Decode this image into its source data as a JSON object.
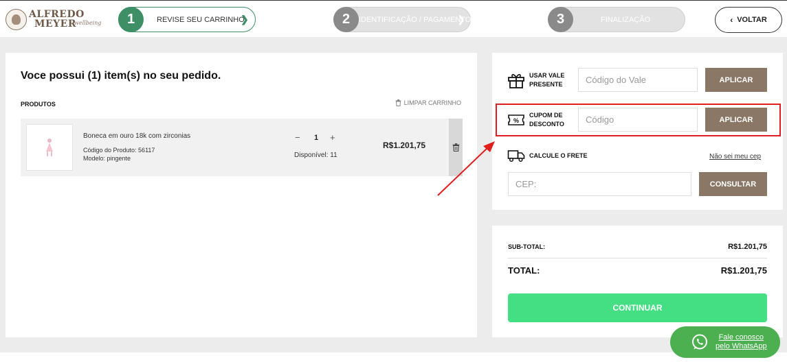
{
  "header": {
    "logo": {
      "line1": "ALFREDO",
      "line2": "MEYER",
      "script": "wellbeing"
    },
    "steps": [
      {
        "num": "1",
        "label": "REVISE SEU CARRINHO"
      },
      {
        "num": "2",
        "label": "IDENTIFICAÇÃO / PAGAMENTO"
      },
      {
        "num": "3",
        "label": "FINALIZAÇÃO"
      }
    ],
    "back_label": "VOLTAR"
  },
  "cart": {
    "title": "Voce possui (1) item(s) no seu pedido.",
    "products_header": "PRODUTOS",
    "clear_label": "LIMPAR CARRINHO",
    "items": [
      {
        "name": "Boneca em ouro 18k com zirconias",
        "code": "Código do Produto: 56117",
        "model": "Modelo: pingente",
        "qty": "1",
        "available": "Disponível: 11",
        "price": "R$1.201,75"
      }
    ]
  },
  "promo": {
    "gift": {
      "label_line1": "USAR VALE",
      "label_line2": "PRESENTE",
      "placeholder": "Código do Vale",
      "button": "APLICAR"
    },
    "coupon": {
      "label_line1": "CUPOM DE",
      "label_line2": "DESCONTO",
      "placeholder": "Código",
      "button": "APLICAR"
    },
    "shipping": {
      "label": "CALCULE O FRETE",
      "link": "Não sei meu cep",
      "placeholder": "CEP:",
      "button": "CONSULTAR"
    }
  },
  "summary": {
    "subtotal_label": "SUB-TOTAL:",
    "subtotal_value": "R$1.201,75",
    "total_label": "TOTAL:",
    "total_value": "R$1.201,75",
    "continue_label": "CONTINUAR"
  },
  "whatsapp": {
    "line1": "Fale conosco",
    "line2": "pelo WhatsApp"
  },
  "colors": {
    "brand": "#8b7765",
    "step_active": "#3f8f66",
    "continue": "#44df82",
    "highlight": "#e21d1d",
    "whatsapp": "#4caf50"
  }
}
